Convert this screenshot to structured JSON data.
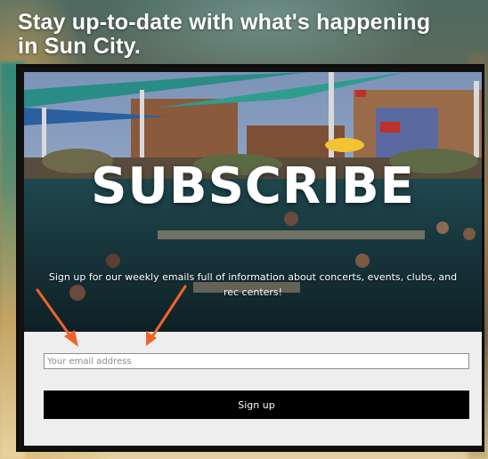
{
  "headline": "Stay up-to-date with what's happening in Sun City.",
  "hero": {
    "title": "SUBSCRIBE",
    "description": "Sign up for our weekly emails full of information about concerts, events, clubs, and rec centers!"
  },
  "form": {
    "email_placeholder": "Your email address",
    "email_value": "",
    "signup_label": "Sign up"
  },
  "annotations": {
    "arrow_color": "#f0642a",
    "arrow_count": 2
  },
  "colors": {
    "button_bg": "#000000",
    "form_bg": "#eeeeee",
    "card_border": "#0d0d0d"
  }
}
